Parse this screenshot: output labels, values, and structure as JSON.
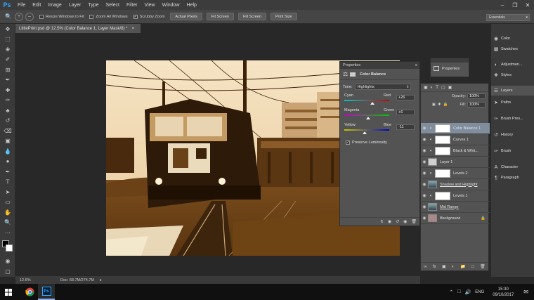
{
  "app": {
    "logo": "Ps"
  },
  "menu": [
    "File",
    "Edit",
    "Image",
    "Layer",
    "Type",
    "Select",
    "Filter",
    "View",
    "Window",
    "Help"
  ],
  "options_bar": {
    "checkboxes": [
      {
        "label": "Resize Windows to Fit",
        "checked": false
      },
      {
        "label": "Zoom All Windows",
        "checked": false
      },
      {
        "label": "Scrubby Zoom",
        "checked": true
      }
    ],
    "buttons": [
      "Actual Pixels",
      "Fit Screen",
      "Fill Screen",
      "Print Size"
    ],
    "workspace": "Essentials"
  },
  "document": {
    "tab_title": "LittlePrint.psd @ 12.5% (Color Balance 1, Layer Mask/8) *",
    "zoom": "12.5%",
    "doc_size": "Doc: 68.7M/274.7M"
  },
  "properties": {
    "panel_title": "Properties",
    "adjustment": "Color Balance",
    "tone_label": "Tone:",
    "tone_value": "Highlights",
    "sliders": [
      {
        "left": "Cyan",
        "right": "Red",
        "value": "+26",
        "position": 0.63
      },
      {
        "left": "Magenta",
        "right": "Green",
        "value": "+6",
        "position": 0.53
      },
      {
        "left": "Yellow",
        "right": "Blue",
        "value": "-11",
        "position": 0.45
      }
    ],
    "preserve_luminosity_label": "Preserve Luminosity",
    "preserve_luminosity": true
  },
  "mini_properties": {
    "label": "Properties"
  },
  "layers": {
    "opacity_label": "Opacity:",
    "opacity": "100%",
    "fill_label": "Fill:",
    "fill": "100%",
    "rows": [
      {
        "name": "Color Balance 1",
        "kind": "adjustment",
        "selected": true
      },
      {
        "name": "Curves 1",
        "kind": "adjustment",
        "selected": false
      },
      {
        "name": "Black & Whit...",
        "kind": "adjustment",
        "selected": false
      },
      {
        "name": "Layer 1",
        "kind": "pixel",
        "selected": false
      },
      {
        "name": "Levels 2",
        "kind": "adjustment",
        "selected": false
      },
      {
        "name": "Shadow and Highlight",
        "kind": "smartfilter",
        "selected": false
      },
      {
        "name": "Levels 1",
        "kind": "adjustment",
        "selected": false
      },
      {
        "name": "Mid Range",
        "kind": "smartfilter",
        "selected": false
      },
      {
        "name": "Background",
        "kind": "background",
        "selected": false
      }
    ]
  },
  "dock": {
    "group1": [
      "Color",
      "Swatches"
    ],
    "group2": [
      "Adjustmen...",
      "Styles"
    ],
    "group3": [
      "Layers",
      "Paths"
    ],
    "group4": [
      "Brush Pres..."
    ],
    "group5": [
      "History"
    ],
    "group6": [
      "Brush"
    ],
    "group7": [
      "Character",
      "Paragraph"
    ]
  },
  "taskbar": {
    "language": "ENG",
    "time": "15:30",
    "date": "09/10/2017"
  },
  "colors": {
    "selected_layer": "#7f8d9d",
    "panel_bg": "#535353",
    "ps_blue": "#31a8ff"
  }
}
